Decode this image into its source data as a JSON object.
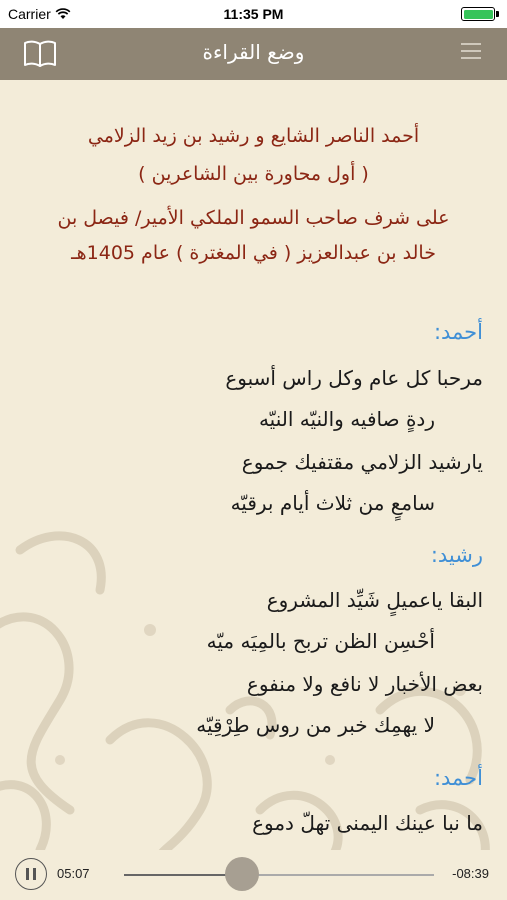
{
  "status_bar": {
    "carrier": "Carrier",
    "time": "11:35 PM",
    "battery_level": 1.0
  },
  "nav": {
    "title": "وضع القراءة",
    "left_icon": "book-icon",
    "right_icon": "menu-icon"
  },
  "poem": {
    "intro": [
      "أحمد الناصر الشايع و رشيد بن زيد الزلامي",
      "( أول محاورة بين الشاعرين )",
      "على شرف صاحب السمو الملكي الأمير/ فيصل بن",
      "خالد بن عبدالعزيز ( في المغترة ) عام 1405هـ"
    ],
    "stanzas": [
      {
        "speaker": "أحمد:",
        "lines": [
          "مرحبا كل عام وكل راس أسبوع",
          "ردةٍ صافيه والنيّه النيّه",
          "يارشيد الزلامي مقتفيك جموع",
          "سامعٍ من ثلاث أيام برقيّه"
        ]
      },
      {
        "speaker": "رشيد:",
        "lines": [
          "البقا ياعميلٍ شَيِّد المشروع",
          "أحْسِن الظن تربح بالمِيَه ميّه",
          "بعض الأخبار لا نافع ولا منفوع",
          "لا يهمِك خبر من روس طِرْقِيّه"
        ]
      },
      {
        "speaker": "أحمد:",
        "lines": [
          "ما نبا عينك اليمنى تهلّ دموع"
        ]
      }
    ]
  },
  "player": {
    "elapsed": "05:07",
    "remaining": "-08:39",
    "progress": 0.38
  },
  "colors": {
    "nav_bg": "#8f8574",
    "intro_text": "#8b2614",
    "speaker_text": "#3f8fd6",
    "page_bg": "#f3ecd9"
  }
}
